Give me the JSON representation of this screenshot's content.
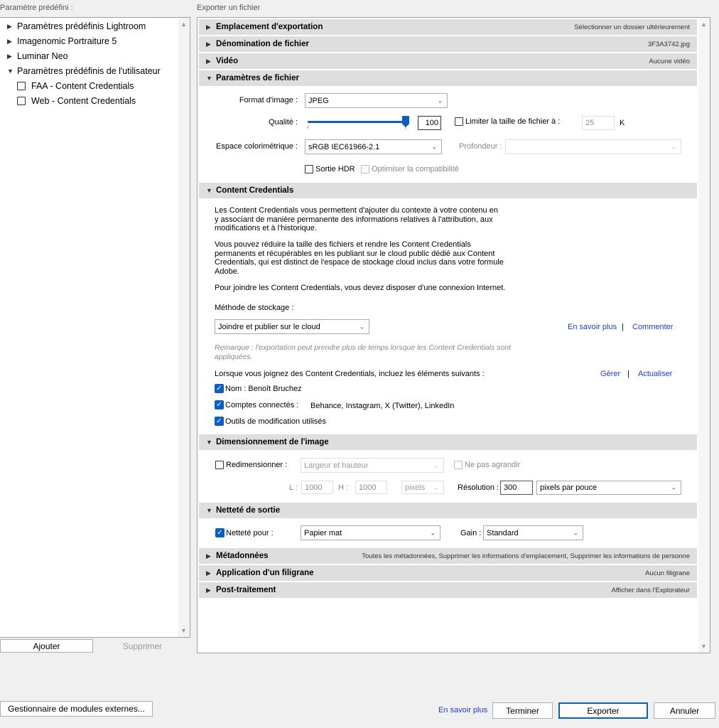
{
  "left": {
    "title": "Paramètre prédéfini :",
    "presets": [
      {
        "label": "Paramètres prédéfinis Lightroom",
        "type": "folder"
      },
      {
        "label": "Imagenomic Portraiture 5",
        "type": "folder"
      },
      {
        "label": "Luminar Neo",
        "type": "folder"
      },
      {
        "label": "Paramètres prédéfinis de l'utilisateur",
        "type": "folder-open"
      },
      {
        "label": "FAA - Content Credentials",
        "type": "item"
      },
      {
        "label": "Web - Content Credentials",
        "type": "item"
      }
    ],
    "add_label": "Ajouter",
    "remove_label": "Supprimer"
  },
  "right": {
    "title": "Exporter un fichier",
    "sections": {
      "export_location": {
        "title": "Emplacement d'exportation",
        "summary": "Sélectionner un dossier ultérieurement"
      },
      "file_naming": {
        "title": "Dénomination de fichier",
        "summary": "3F3A3742.jpg"
      },
      "video": {
        "title": "Vidéo",
        "summary": "Aucune vidéo"
      },
      "file_settings": {
        "title": "Paramètres de fichier",
        "format_label": "Format d'image :",
        "format_value": "JPEG",
        "quality_label": "Qualité :",
        "quality_value": "100",
        "quality_level": 1.0,
        "limit_label": "Limiter la taille de fichier à :",
        "limit_value": "25",
        "limit_unit": "K",
        "colorspace_label": "Espace colorimétrique :",
        "colorspace_value": "sRGB IEC61966-2.1",
        "depth_label": "Profondeur :",
        "depth_value": "",
        "hdr_label": "Sortie HDR",
        "compat_label": "Optimiser la compatibilité"
      },
      "content_credentials": {
        "title": "Content Credentials",
        "para1": [
          "Les Content Credentials vous permettent d'ajouter du contexte à votre contenu en",
          "y associant de manière permanente des informations relatives à l'attribution, aux",
          "modifications et à l'historique."
        ],
        "para2": [
          "Vous pouvez réduire la taille des fichiers et rendre les Content Credentials",
          "permanents et récupérables en les publiant sur le cloud public dédié aux Content",
          "Credentials, qui est distinct de l'espace de stockage cloud inclus dans votre formule",
          "Adobe."
        ],
        "para3": "Pour joindre les Content Credentials, vous devez disposer d'une connexion Internet.",
        "storage_label": "Méthode de stockage :",
        "storage_value": "Joindre et publier sur le cloud",
        "learn_more": "En savoir plus",
        "sep": "|",
        "comment": "Commenter",
        "note": [
          "Remarque : l'exportation peut prendre plus de temps lorsque les Content Credentials sont",
          "appliquées."
        ],
        "include_label": "Lorsque vous joignez des Content Credentials, incluez les éléments suivants :",
        "manage": "Gérer",
        "refresh": "Actualiser",
        "name_label": "Nom : Benoît Bruchez",
        "accounts_label": "Comptes connectés :",
        "accounts_value": "Behance, Instagram, X (Twitter), LinkedIn",
        "tools_label": "Outils de modification utilisés"
      },
      "sizing": {
        "title": "Dimensionnement de l'image",
        "resize_label": "Redimensionner :",
        "resize_mode": "Largeur et hauteur",
        "no_enlarge": "Ne pas agrandir",
        "w_label": "L :",
        "w_value": "1000",
        "h_label": "H :",
        "h_value": "1000",
        "unit": "pixels",
        "res_label": "Résolution :",
        "res_value": "300",
        "res_unit": "pixels par pouce"
      },
      "sharpening": {
        "title": "Netteté de sortie",
        "sharpen_label": "Netteté pour :",
        "sharpen_value": "Papier mat",
        "gain_label": "Gain :",
        "gain_value": "Standard"
      },
      "metadata": {
        "title": "Métadonnées",
        "summary": "Toutes les métadonnées, Supprimer les informations d'emplacement, Supprimer les informations de personne"
      },
      "watermark": {
        "title": "Application d'un filigrane",
        "summary": "Aucun filigrane"
      },
      "post": {
        "title": "Post-traitement",
        "summary": "Afficher dans l'Explorateur"
      }
    }
  },
  "footer": {
    "plugin_manager": "Gestionnaire de modules externes...",
    "learn_more": "En savoir plus",
    "done": "Terminer",
    "export": "Exporter",
    "cancel": "Annuler"
  }
}
